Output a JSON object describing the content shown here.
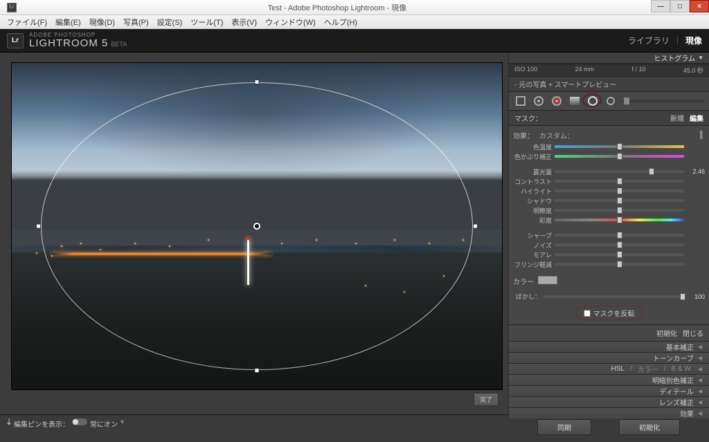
{
  "titlebar": {
    "title": "Test - Adobe Photoshop Lightroom - 現像"
  },
  "menu": {
    "file": "ファイル(F)",
    "edit": "編集(E)",
    "develop": "現像(D)",
    "photo": "写真(P)",
    "settings": "設定(S)",
    "tool": "ツール(T)",
    "view": "表示(V)",
    "window": "ウィンドウ(W)",
    "help": "ヘルプ(H)"
  },
  "brand": {
    "small": "ADOBE PHOTOSHOP",
    "big": "LIGHTROOM 5",
    "beta": "BETA",
    "lr": "Lr"
  },
  "modules": {
    "library": "ライブラリ",
    "develop": "現像"
  },
  "histogram_label": "ヒストグラム",
  "exif": {
    "iso": "ISO 100",
    "focal": "24 mm",
    "aperture": "f / 10",
    "shutter": "45.0 秒"
  },
  "orig_preview": "元の写真 + スマートプレビュー",
  "mask": {
    "label": "マスク：",
    "new": "新規",
    "edit": "編集"
  },
  "effect": {
    "head_label": "効果：",
    "custom": "カスタム：",
    "temp": "色温度",
    "tint": "色かぶり補正",
    "exposure": "露光量",
    "exposure_val": "2.46",
    "contrast": "コントラスト",
    "highlights": "ハイライト",
    "shadows": "シャドウ",
    "clarity": "明瞭度",
    "saturation": "彩度",
    "sharpness": "シャープ",
    "noise": "ノイズ",
    "moire": "モアレ",
    "fringe": "フリンジ軽減"
  },
  "color_label": "カラー",
  "feather": {
    "label": "ぼかし：",
    "value": "100"
  },
  "invert": "マスクを反転",
  "actions": {
    "reset": "初期化",
    "close": "閉じる"
  },
  "panels": {
    "basic": "基本補正",
    "tonecurve": "トーンカーブ",
    "hsl": "HSL",
    "color": "カラー",
    "bw": "B & W",
    "splittone": "明暗別色補正",
    "detail": "ディテール",
    "lens": "レンズ補正",
    "effects": "効果"
  },
  "footer": {
    "pins": "編集ピンを表示：",
    "always": "常にオン",
    "done": "完了",
    "sync": "同期",
    "reset": "初期化"
  }
}
